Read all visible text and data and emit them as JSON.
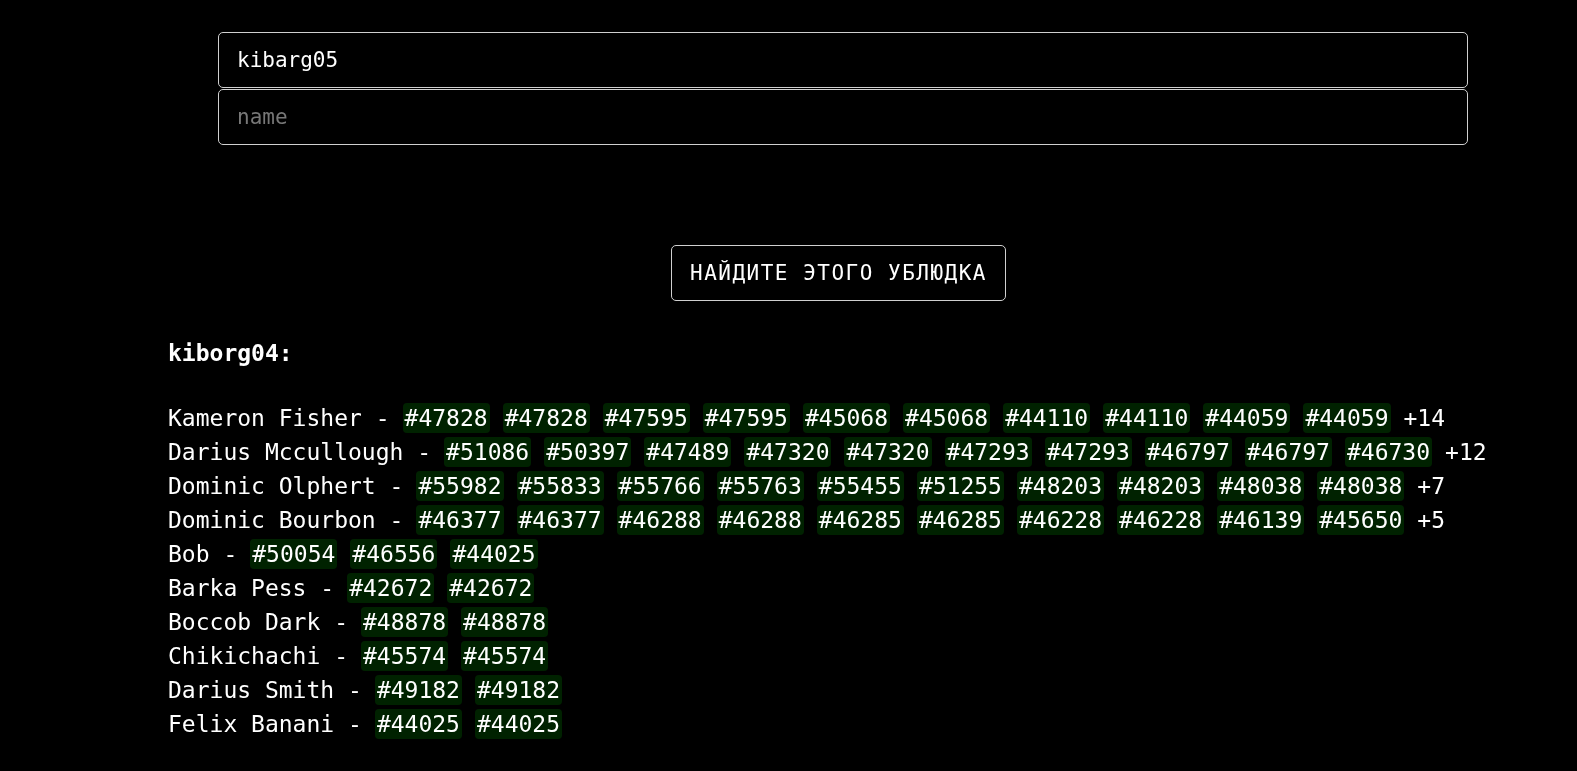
{
  "form": {
    "user_field": {
      "value": "kibarg05"
    },
    "name_field": {
      "placeholder": "name"
    },
    "submit_button": "НАЙДИТЕ ЭТОГО УБЛЮДКА"
  },
  "result": {
    "heading": "kiborg04:",
    "rows": [
      {
        "label": "Kameron Fisher -",
        "tags": [
          "#47828",
          "#47828",
          "#47595",
          "#47595",
          "#45068",
          "#45068",
          "#44110",
          "#44110",
          "#44059",
          "#44059"
        ],
        "more": "+14"
      },
      {
        "label": "Darius Mccullough -",
        "tags": [
          "#51086",
          "#50397",
          "#47489",
          "#47320",
          "#47320",
          "#47293",
          "#47293",
          "#46797",
          "#46797",
          "#46730"
        ],
        "more": "+12"
      },
      {
        "label": "Dominic Olphert -",
        "tags": [
          "#55982",
          "#55833",
          "#55766",
          "#55763",
          "#55455",
          "#51255",
          "#48203",
          "#48203",
          "#48038",
          "#48038"
        ],
        "more": "+7"
      },
      {
        "label": "Dominic Bourbon -",
        "tags": [
          "#46377",
          "#46377",
          "#46288",
          "#46288",
          "#46285",
          "#46285",
          "#46228",
          "#46228",
          "#46139",
          "#45650"
        ],
        "more": "+5"
      },
      {
        "label": "Bob -",
        "tags": [
          "#50054",
          "#46556",
          "#44025"
        ]
      },
      {
        "label": "Barka Pess -",
        "tags": [
          "#42672",
          "#42672"
        ]
      },
      {
        "label": "Boccob Dark -",
        "tags": [
          "#48878",
          "#48878"
        ]
      },
      {
        "label": "Chikichachi -",
        "tags": [
          "#45574",
          "#45574"
        ]
      },
      {
        "label": "Darius Smith -",
        "tags": [
          "#49182",
          "#49182"
        ]
      },
      {
        "label": "Felix Banani -",
        "tags": [
          "#44025",
          "#44025"
        ]
      }
    ]
  }
}
